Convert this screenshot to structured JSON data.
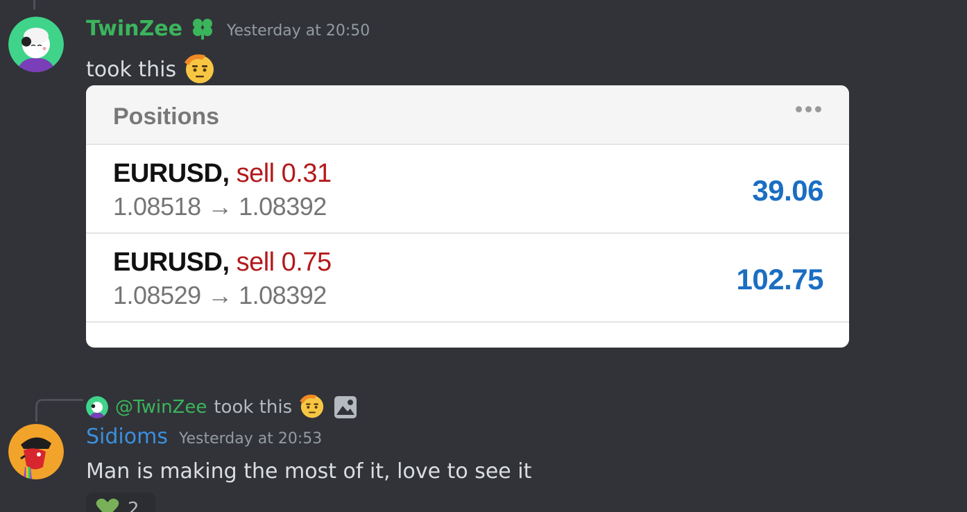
{
  "messages": [
    {
      "author": "TwinZee",
      "author_color": "#3bb55c",
      "badge_icon": "clover-badge-icon",
      "timestamp": "Yesterday at 20:50",
      "text": "took this",
      "emoji": "saluting-face-emoji",
      "attachment": {
        "title": "Positions",
        "more_icon": "more-horizontal-icon",
        "positions": [
          {
            "symbol": "EURUSD,",
            "side": "sell 0.31",
            "prices": "1.08518 → 1.08392",
            "profit": "39.06"
          },
          {
            "symbol": "EURUSD,",
            "side": "sell 0.75",
            "prices": "1.08529 → 1.08392",
            "profit": "102.75"
          }
        ]
      }
    },
    {
      "reply": {
        "author": "@TwinZee",
        "text": "took this",
        "emoji": "saluting-face-emoji",
        "attachment_icon": "image-icon"
      },
      "author": "Sidioms",
      "author_color": "#3b8fe0",
      "timestamp": "Yesterday at 20:53",
      "text": "Man is making the most of it, love to see it",
      "reaction": {
        "emoji": "green-heart-emoji",
        "count": "2"
      }
    }
  ],
  "colors": {
    "background": "#313338",
    "profit_blue": "#1b6ec2",
    "sell_red": "#b3191b"
  }
}
